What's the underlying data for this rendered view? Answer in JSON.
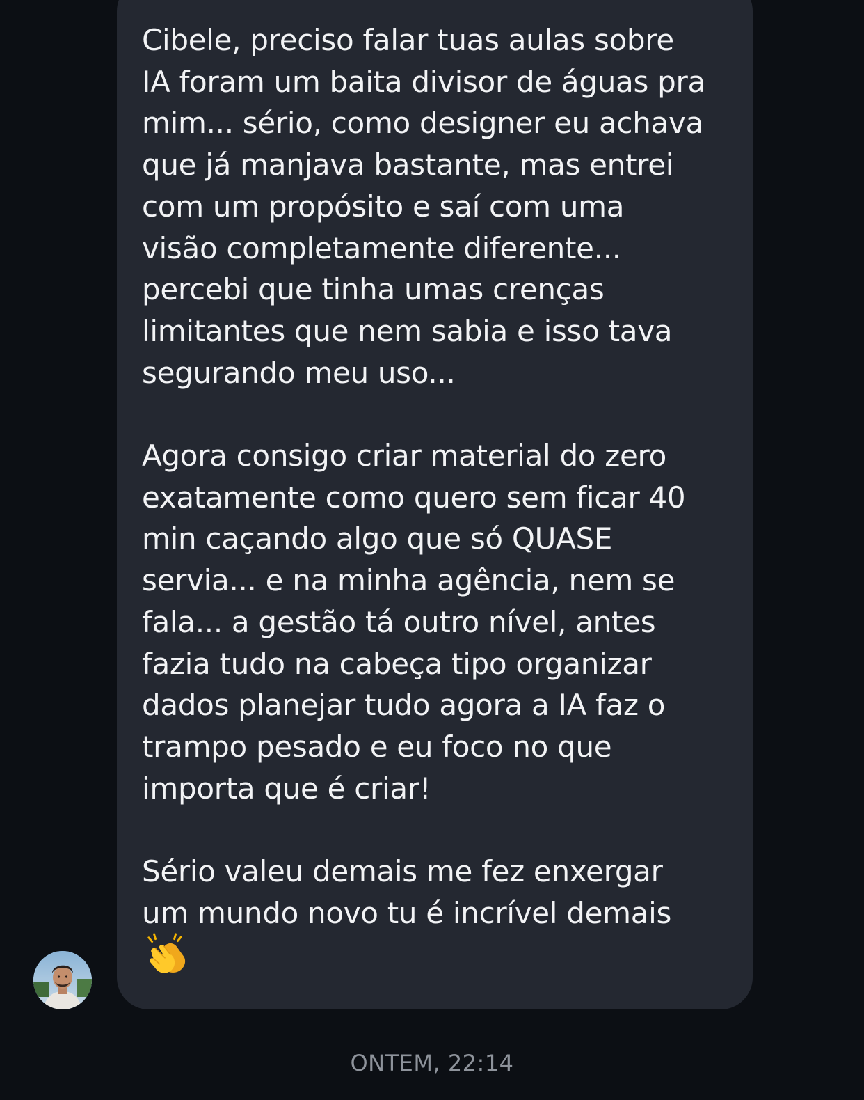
{
  "message": {
    "paragraphs": [
      "Cibele, preciso falar tuas aulas sobre\nIA foram um baita divisor de águas pra\nmim... sério, como designer eu achava\nque já manjava bastante, mas entrei\ncom um propósito e saí com uma\nvisão completamente diferente...\npercebi que tinha umas crenças\nlimitantes que nem sabia e isso tava\nsegurando meu uso...",
      "Agora consigo criar material do zero\nexatamente como quero sem ficar 40\nmin caçando algo que só QUASE\nservia... e na minha agência, nem se\nfala... a gestão tá outro nível, antes\nfazia tudo na cabeça tipo organizar\ndados planejar tudo agora a IA faz o\ntrampo pesado e eu foco no que\nimporta que é criar!",
      "Sério valeu demais me fez enxergar\num mundo novo tu é incrível demais"
    ],
    "emoji": "clapping-hands"
  },
  "sender": {
    "avatar": "profile-photo"
  },
  "timestamp": "ONTEM, 22:14",
  "colors": {
    "background": "#0c0f14",
    "bubble": "#242831",
    "text": "#f2f3f5",
    "timestamp": "#8e939b"
  }
}
